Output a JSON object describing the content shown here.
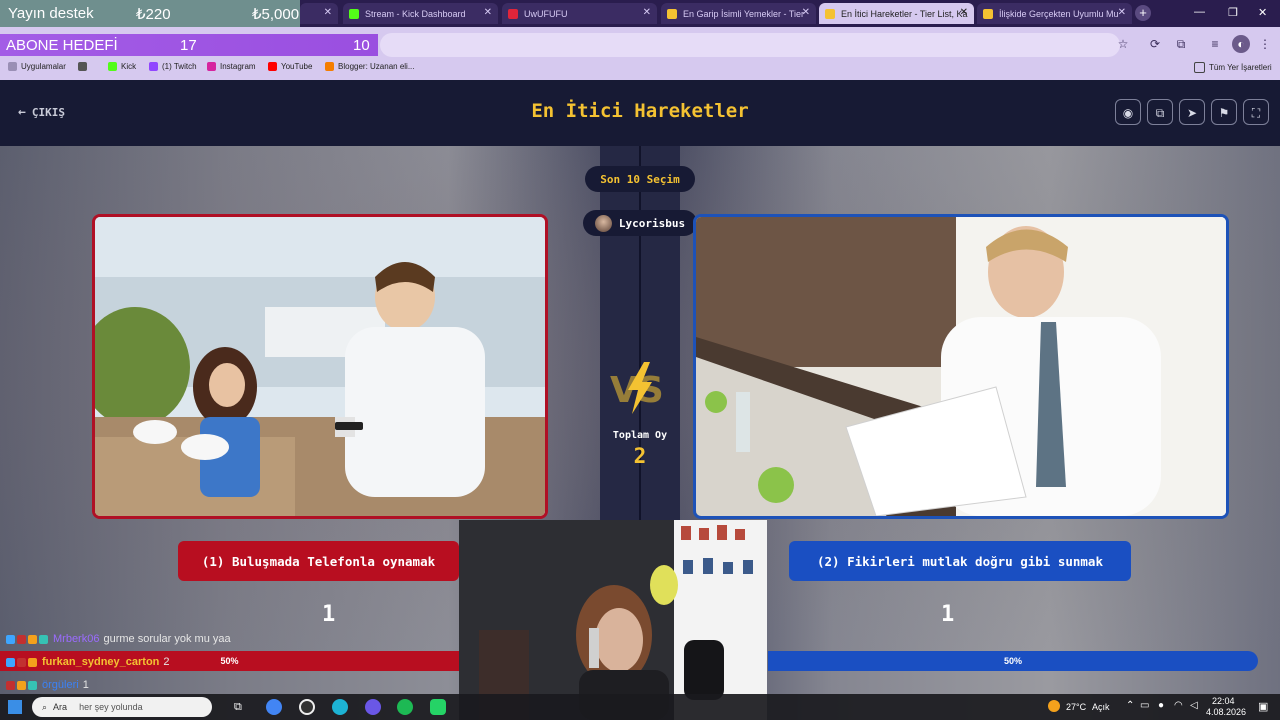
{
  "browser": {
    "tabs": [
      {
        "label": "",
        "color": "#6f8f8e"
      },
      {
        "label": "Stream - Kick Dashboard",
        "color": "#53fc18"
      },
      {
        "label": "UwUFUFU",
        "color": "#e0253a"
      },
      {
        "label": "En Garip İsimli Yemekler - Tier",
        "color": "#f4c232"
      },
      {
        "label": "En İtici Hareketler - Tier List, Ka",
        "color": "#f4c232"
      },
      {
        "label": "İlişkide Gerçekten Uyumlu Mu",
        "color": "#f4c232"
      }
    ],
    "bookmarks": [
      {
        "label": "Uygulamalar",
        "color": "#9a8fb5"
      },
      {
        "label": "Kick",
        "color": "#53fc18"
      },
      {
        "label": "(1) Twitch",
        "color": "#9146ff"
      },
      {
        "label": "Instagram",
        "color": "#d6249f"
      },
      {
        "label": "YouTube",
        "color": "#ff0000"
      },
      {
        "label": "Blogger: Uzanan eli...",
        "color": "#f57d00"
      }
    ],
    "bookmarks_right": "Tüm Yer İşaretleri"
  },
  "overlay": {
    "donation_label": "Yayın destek",
    "donation_current": "₺220",
    "donation_target": "₺5,000",
    "sub_label": "ABONE HEDEFİ",
    "sub_current": "17",
    "sub_target": "10"
  },
  "app": {
    "title": "En İtici Hareketler",
    "back_label": "ÇIKIŞ",
    "recent_label": "Son 10 Seçim",
    "voter": "Lycorisbus",
    "total_label": "Toplam Oy",
    "total_value": "2",
    "left": {
      "label": "(1) Buluşmada Telefonla oynamak",
      "count": "1",
      "percent": "50%",
      "accent": "#b80e20"
    },
    "right": {
      "label": "(2) Fikirleri mutlak doğru gibi sunmak",
      "count": "1",
      "percent": "50%",
      "accent": "#1a4fc2"
    }
  },
  "chat": [
    {
      "user": "Mrberk06",
      "user_color": "#9b6bff",
      "text": "gurme sorular yok mu yaa"
    },
    {
      "user": "furkan_sydney_carton",
      "user_color": "#f4c232",
      "text": "2"
    },
    {
      "user": "örgüleri",
      "user_color": "#3b82f6",
      "text": "1"
    },
    {
      "user": "",
      "user_color": "#cccccc",
      "text": "her şey yolunda"
    }
  ],
  "taskbar": {
    "search": "Ara",
    "weather": "27°C",
    "weather_state": "Açık",
    "time": "22:04",
    "date": "4.08.2026"
  }
}
